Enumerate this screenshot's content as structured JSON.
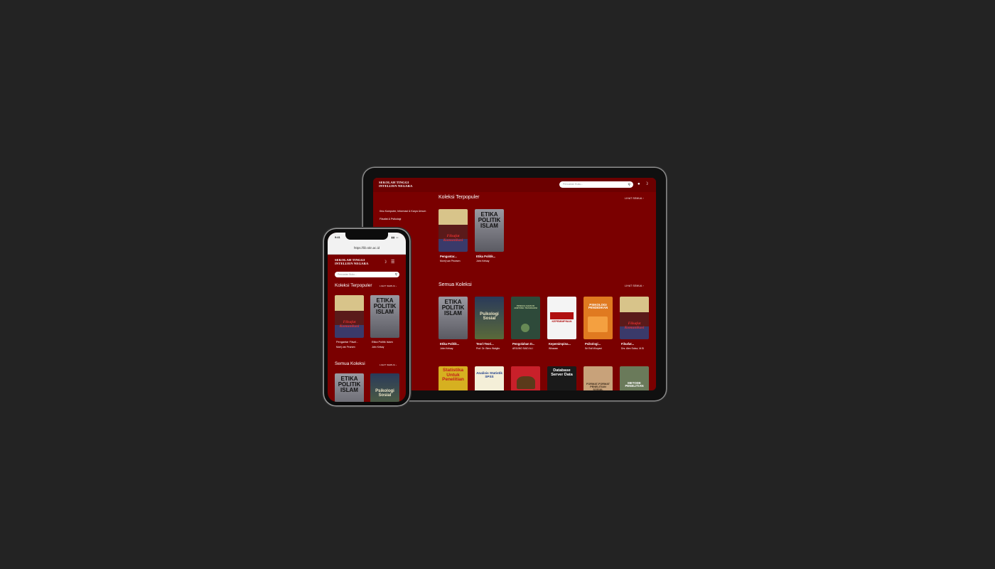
{
  "app": {
    "brand_line1": "SEKOLAH TINGGI",
    "brand_line2": "INTELIJEN NEGARA",
    "search_placeholder": "Pencarian Buku...",
    "search_icon": "search-icon",
    "user_icon": "user-icon",
    "theme_icon": "moon-icon",
    "menu_icon": "menu-icon"
  },
  "sidebar": {
    "items": [
      {
        "label": "Ilmu Komputer, Informasi & Karya Umum"
      },
      {
        "label": "Filsafat & Psikologi"
      },
      {
        "label": "..."
      },
      {
        "label": "...si"
      }
    ]
  },
  "popular": {
    "title": "Koleksi Terpopuler",
    "see_all": "LIHAT SEMUA",
    "books": [
      {
        "title": "Pengantar...",
        "author": "Morrij van Peursen",
        "cover_text": "Filsafat Komunikasi",
        "cover_color": "#3a3a6a",
        "accent": "#c21a1a"
      },
      {
        "title": "Etika Politik...",
        "author": "John Kelsay",
        "cover_text": "ETIKA POLITIK ISLAM",
        "cover_color": "#8a8a90",
        "accent": "#1a1a1a"
      }
    ]
  },
  "all": {
    "title": "Semua Koleksi",
    "see_all": "LIHAT SEMUA",
    "books": [
      {
        "title": "Etika Politik...",
        "author": "John Kelsay",
        "cover_text": "ETIKA POLITIK ISLAM",
        "cover_color": "#8a8a90",
        "accent": "#1a1a1a"
      },
      {
        "title": "Teori-Teori...",
        "author": "Prof. Dr. Bimo Walgito",
        "cover_text": "Psikologi Sosial",
        "cover_color": "#4a5a3a",
        "accent": "#e8e0c0"
      },
      {
        "title": "Pengolahan D...",
        "author": "ARJUNO SAID ALI",
        "cover_text": "PENGOLAHAN DI JANTUNG TRANSAKSI",
        "cover_color": "#2e4a3a",
        "accent": "#c8d8a0"
      },
      {
        "title": "Kepemimpina...",
        "author": "Wirawan",
        "cover_text": "KEPEMIMPINAN",
        "cover_color": "#f4f4f4",
        "accent": "#b01010"
      },
      {
        "title": "Psikologi...",
        "author": "Sri Esti Wuryani",
        "cover_text": "PSIKOLOGI PENDIDIKAN",
        "cover_color": "#e07a20",
        "accent": "#ffffff"
      },
      {
        "title": "Filsafat...",
        "author": "Drs. Alex Sobur, M.Si",
        "cover_text": "Filsafat Komunikasi",
        "cover_color": "#3a3a6a",
        "accent": "#c21a1a"
      }
    ],
    "row2": [
      {
        "cover_text": "Statistika Untuk Penelitian",
        "cover_color": "#d6b020",
        "accent": "#c21a1a"
      },
      {
        "cover_text": "Analisis Statistik SPSS",
        "cover_color": "#f4efd8",
        "accent": "#1a3a8a"
      },
      {
        "cover_text": "",
        "cover_color": "#c8202a",
        "accent": "#ffffff"
      },
      {
        "cover_text": "Database Server Data",
        "cover_color": "#1a1a1a",
        "accent": "#ffffff"
      },
      {
        "cover_text": "FORMAT-FORMAT PENELITIAN SOSIAL",
        "cover_color": "#c8a27a",
        "accent": "#3a2a1a"
      },
      {
        "cover_text": "METODE PENELITIAN",
        "cover_color": "#6a7a5a",
        "accent": "#ffffff"
      }
    ]
  },
  "phone": {
    "time": "9:41",
    "url": "https://lib.stin.ac.id",
    "popular_books": [
      {
        "title": "Pengantar Filsaf...",
        "author": "Morrij van Peursen"
      },
      {
        "title": "Etika Politik Islam",
        "author": "John Kelsay"
      }
    ]
  }
}
